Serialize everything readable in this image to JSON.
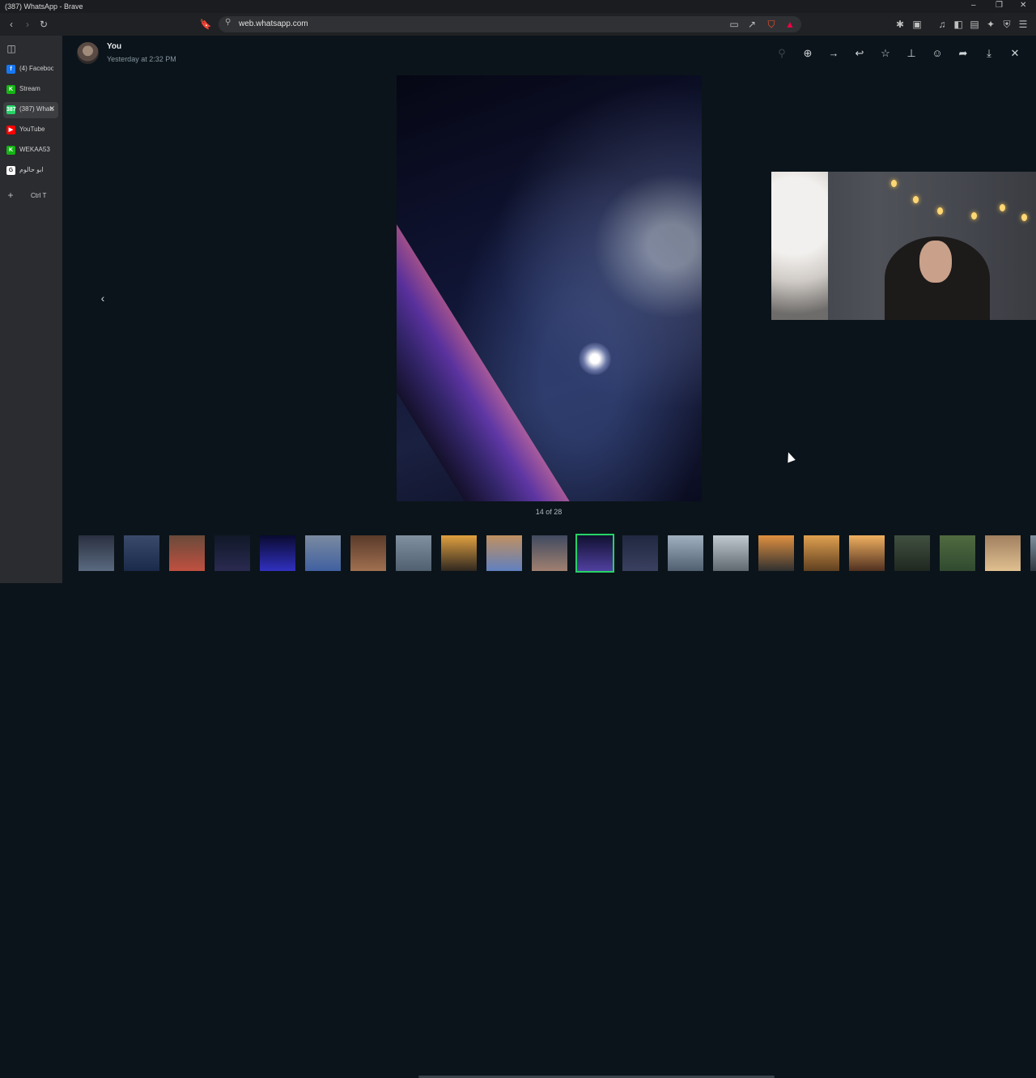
{
  "window": {
    "title": "(387) WhatsApp - Brave"
  },
  "browser": {
    "url": "web.whatsapp.com",
    "tabs": [
      {
        "label": "(4) Facebook",
        "fav_text": "f",
        "fav_color": "#1877f2"
      },
      {
        "label": "Stream",
        "fav_text": "K",
        "fav_color": "#16b316"
      },
      {
        "label": "(387) WhatsApp",
        "fav_text": "387",
        "fav_color": "#25d366",
        "active": true
      },
      {
        "label": "YouTube",
        "fav_text": "▶",
        "fav_color": "#ff0000"
      },
      {
        "label": "WEKAA53",
        "fav_text": "K",
        "fav_color": "#16b316"
      },
      {
        "label": "ابو حالوم",
        "fav_text": "G",
        "fav_color": "#ffffff"
      }
    ],
    "new_tab_shortcut": "Ctrl T"
  },
  "viewer": {
    "sender": "You",
    "sent_time": "Yesterday at 2:32 PM",
    "counter": "14 of 28",
    "current_index": 14,
    "total": 28,
    "actions": [
      "zoom-in",
      "forward-arrow",
      "reply",
      "star",
      "pin",
      "react-emoji",
      "forward",
      "download",
      "close"
    ]
  },
  "colors": {
    "accent": "#25d366",
    "background": "#0b141a",
    "icon": "#d1d7db"
  }
}
